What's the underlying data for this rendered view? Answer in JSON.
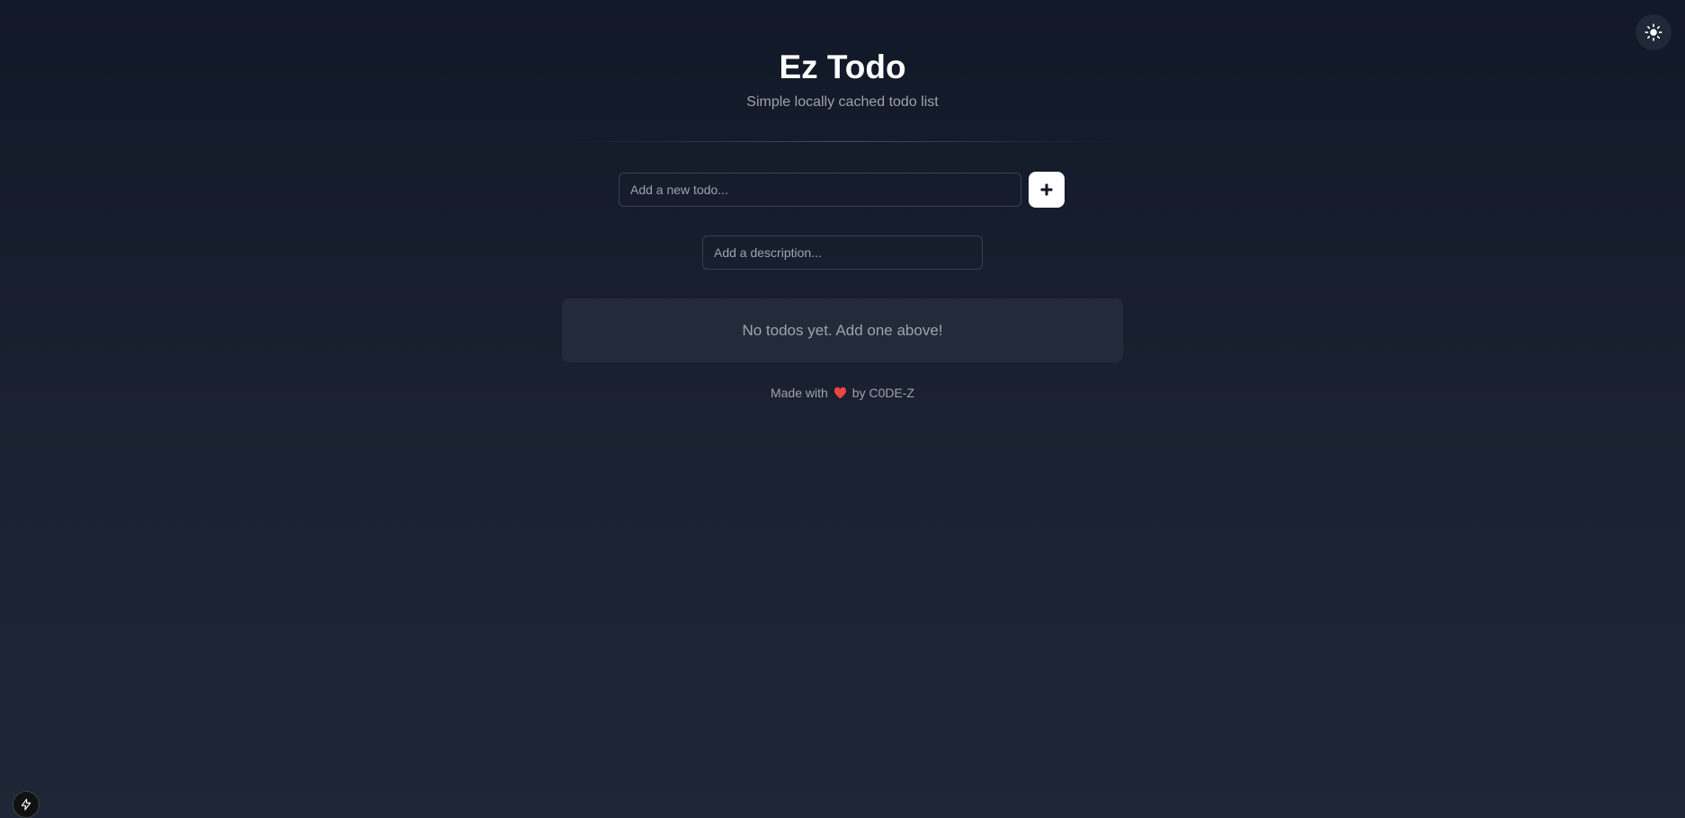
{
  "header": {
    "title": "Ez Todo",
    "subtitle": "Simple locally cached todo list"
  },
  "form": {
    "todo_placeholder": "Add a new todo...",
    "todo_value": "",
    "description_placeholder": "Add a description...",
    "description_value": "",
    "add_button_icon": "plus-icon"
  },
  "list": {
    "empty_message": "No todos yet. Add one above!"
  },
  "footer": {
    "made_with": "Made with",
    "by_text": "by C0DE-Z",
    "heart_icon": "heart-icon"
  },
  "toolbar": {
    "theme_toggle_icon": "sun-icon",
    "dev_badge_icon": "lightning-icon"
  },
  "colors": {
    "background": "#111827",
    "heart": "#ef4444",
    "button_bg": "#ffffff",
    "empty_box_bg": "#232b3a",
    "muted_text": "#9ca3af"
  }
}
